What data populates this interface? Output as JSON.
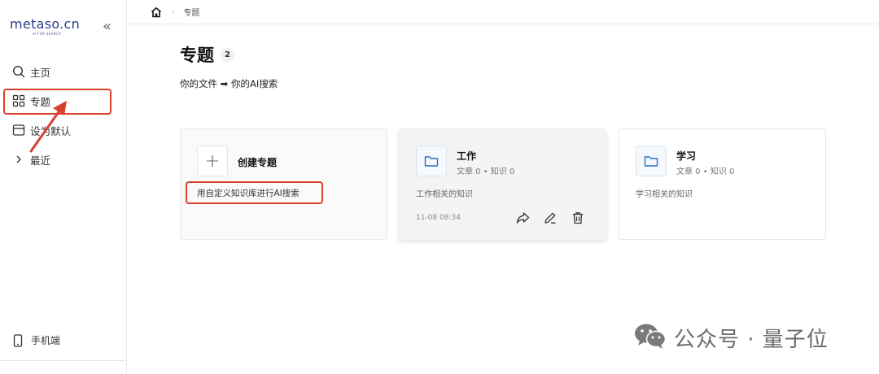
{
  "sidebar": {
    "logo": "metaso.cn",
    "logo_sub": "AI FOR SEARCH",
    "collapse_icon": "double-chevron-left-icon",
    "items": [
      {
        "label": "主页",
        "icon": "search-icon"
      },
      {
        "label": "专题",
        "icon": "grid-icon"
      },
      {
        "label": "设为默认",
        "icon": "window-icon"
      },
      {
        "label": "最近",
        "icon": "chevron-right-icon"
      }
    ],
    "mobile_label": "手机端"
  },
  "breadcrumb": {
    "home_icon": "home-icon",
    "current": "专题"
  },
  "main": {
    "title": "专题",
    "count": "2",
    "subtitle": "你的文件 ➡ 你的AI搜索",
    "create_card": {
      "title": "创建专题",
      "description": "用自定义知识库进行AI搜索"
    },
    "topics": [
      {
        "name": "工作",
        "meta": "文章 0 • 知识 0",
        "description": "工作相关的知识",
        "time": "11-08 08:34"
      },
      {
        "name": "学习",
        "meta": "文章 0 • 知识 0",
        "description": "学习相关的知识"
      }
    ]
  },
  "watermark": "公众号 · 量子位",
  "colors": {
    "highlight": "#d9412f",
    "logo": "#2b3a8f"
  }
}
